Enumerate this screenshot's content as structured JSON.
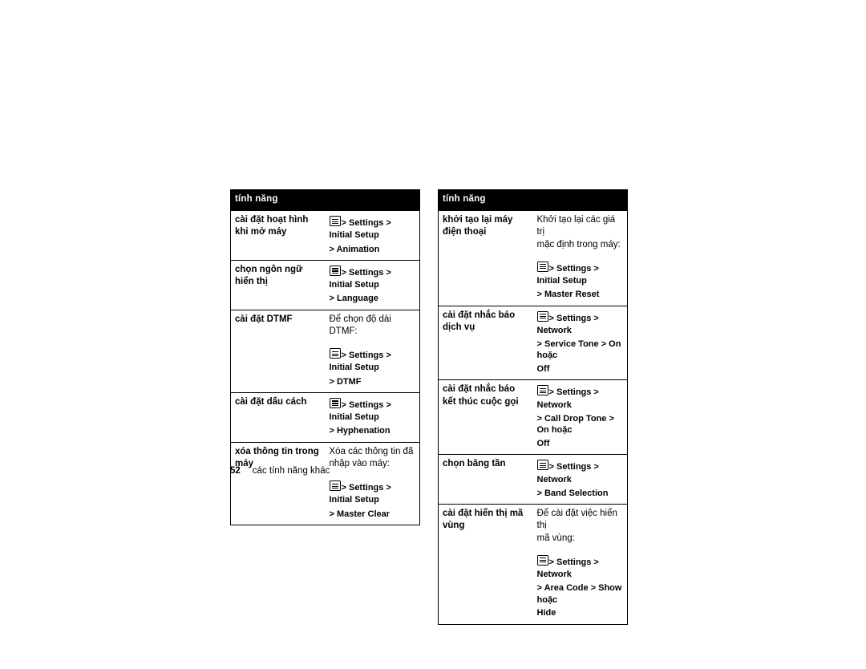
{
  "page": {
    "number": "52",
    "footer_text": "các tính năng khác"
  },
  "icons": {
    "menu_key": "menu-key-icon"
  },
  "left_table": {
    "header": "tính năng",
    "rows": [
      {
        "term": "cài đặt hoạt hình khi mở máy",
        "desc_lines": [],
        "paths": [
          "> Settings > Initial Setup",
          "> Animation"
        ]
      },
      {
        "term": "chọn ngôn ngữ hiển thị",
        "desc_lines": [],
        "paths": [
          "> Settings > Initial Setup",
          "> Language"
        ]
      },
      {
        "term": "cài đặt DTMF",
        "desc_lines": [
          "Để chọn độ dài DTMF:"
        ],
        "paths": [
          "> Settings > Initial Setup",
          "> DTMF"
        ]
      },
      {
        "term": "cài đặt dấu cách",
        "desc_lines": [],
        "paths": [
          "> Settings > Initial Setup",
          "> Hyphenation"
        ]
      },
      {
        "term": "xóa thông tin trong máy",
        "desc_lines": [
          "Xóa các thông tin đã",
          "nhập vào máy:"
        ],
        "paths": [
          "> Settings > Initial Setup",
          "> Master Clear"
        ]
      }
    ]
  },
  "right_table": {
    "header": "tính năng",
    "rows": [
      {
        "term": "khởi tạo lại máy điện thoại",
        "desc_lines": [
          "Khởi tạo lại các giá trị",
          "mặc định trong máy:"
        ],
        "paths": [
          "> Settings > Initial Setup",
          "> Master Reset"
        ]
      },
      {
        "term": "cài đặt nhắc báo dịch vụ",
        "desc_lines": [],
        "paths": [
          "> Settings > Network",
          "> Service Tone > On hoặc",
          "Off"
        ]
      },
      {
        "term": "cài đặt nhắc báo kết thúc cuộc gọi",
        "desc_lines": [],
        "paths": [
          "> Settings > Network",
          "> Call Drop Tone > On hoặc",
          "Off"
        ]
      },
      {
        "term": "chọn băng tần",
        "desc_lines": [],
        "paths": [
          "> Settings > Network",
          "> Band Selection"
        ]
      },
      {
        "term": "cài đặt hiển thị mã vùng",
        "desc_lines": [
          "Để cài đặt việc hiển thị",
          "mã vùng:"
        ],
        "paths": [
          "> Settings > Network",
          "> Area Code > Show hoặc",
          "Hide"
        ]
      }
    ]
  }
}
